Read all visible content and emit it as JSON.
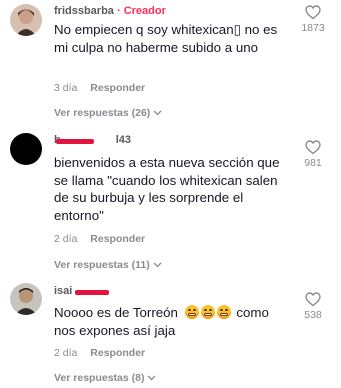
{
  "comments": [
    {
      "author": "fridssbarba",
      "badge": "· Creador",
      "text": "No empiecen q soy whitexican▯ no es mi culpa no haberme subido a uno",
      "age": "3 día",
      "reply_label": "Responder",
      "view_replies": "Ver respuestas (26)",
      "likes": "1873",
      "avatar_color": "#c9a08a"
    },
    {
      "author": "b     l43",
      "text": "bienvenidos a esta nueva sección que se llama \"cuando los whitexican salen de su burbuja y les sorprende el entorno\"",
      "age": "2 día",
      "reply_label": "Responder",
      "view_replies": "Ver respuestas (11)",
      "likes": "981",
      "avatar_color": "#000000"
    },
    {
      "author": "isai",
      "text_before": "Noooo es de Torreón",
      "emoji_name": "grimacing-face-emoji",
      "text_after": "como nos expones así jaja",
      "age": "2 día",
      "reply_label": "Responder",
      "view_replies": "Ver respuestas (8)",
      "likes": "538",
      "avatar_color": "#2f2a28"
    }
  ],
  "colors": {
    "text": "#161823",
    "secondary": "#8a8b91",
    "creator": "#fe2c55",
    "redaction": "#e0143c"
  },
  "icons": [
    "heart-outline-icon",
    "chevron-down-icon"
  ]
}
